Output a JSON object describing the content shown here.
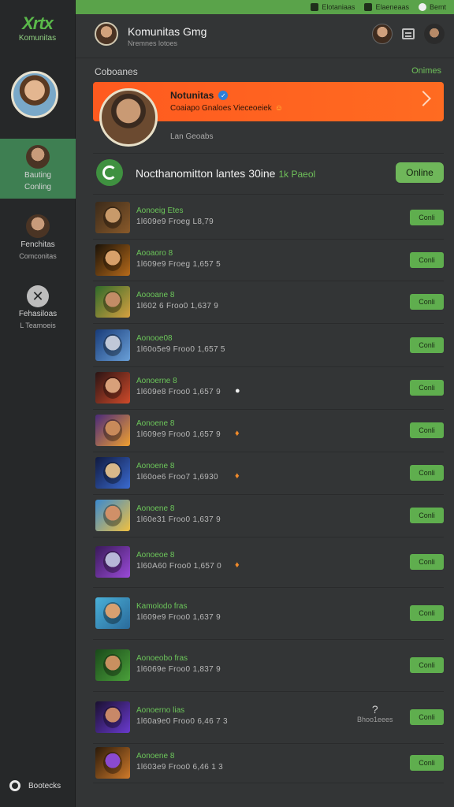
{
  "top_strip": {
    "items": [
      "Elotaniaas",
      "Elaeneaas",
      "Bemt"
    ]
  },
  "sidebar": {
    "logo_mark": "Xrtx",
    "logo_text": "Komunitas",
    "active_item": {
      "line1": "Bauting",
      "line2": "Conling"
    },
    "items": [
      {
        "line1": "Fenchitas",
        "line2": "Comconitas"
      },
      {
        "line1": "Fehasiloas",
        "line2": "L Teamoeis"
      }
    ],
    "bottom_label": "Bootecks"
  },
  "header": {
    "title": "Komunitas Gmg",
    "subtitle": "Nremnes lotoes"
  },
  "section": {
    "label": "Coboanes",
    "link": "Onimes"
  },
  "featured": {
    "title": "Notunitas",
    "verified_icon": "verified-icon",
    "subtitle": "Coaiapo Gnaloes Vieceoeiek",
    "emoji": "☺",
    "meta": "Lan Geoabs"
  },
  "online_bar": {
    "text": "Nocthanomitton lantes 30ine",
    "highlight": "1k Paeol",
    "button": "Online"
  },
  "rows": [
    {
      "name": "Aonoeig Etes",
      "info": "1l609e9 Froeg L8,79",
      "emoji": "",
      "side_big": "",
      "side_small": "",
      "button": "Conli",
      "thumb": [
        "#3a2a1a",
        "#8a5a2a",
        "#c89a6a"
      ]
    },
    {
      "name": "Aooaoro 8",
      "info": "1l609e9 Froeg 1,657 5",
      "emoji": "",
      "side_big": "",
      "side_small": "",
      "button": "Conli",
      "thumb": [
        "#1a1208",
        "#b66a1a",
        "#d8a06a"
      ]
    },
    {
      "name": "Aoooane 8",
      "info": "1l602 6 Froo0 1,637 9",
      "emoji": "",
      "side_big": "",
      "side_small": "",
      "button": "Conli",
      "thumb": [
        "#2f6a2a",
        "#d6a040",
        "#c38c66"
      ]
    },
    {
      "name": "Aonooe08",
      "info": "1l60o5e9 Froo0 1,657 5",
      "emoji": "",
      "side_big": "",
      "side_small": "",
      "button": "Conli",
      "thumb": [
        "#183c7a",
        "#6aa0d8",
        "#c0c8d8"
      ]
    },
    {
      "name": "Aonoerne 8",
      "info": "1l609e8 Froo0 1,657 9",
      "emoji": "●",
      "side_big": "",
      "side_small": "",
      "button": "Conli",
      "thumb": [
        "#2a1414",
        "#d04a2a",
        "#d8a07a"
      ]
    },
    {
      "name": "Aonoene 8",
      "info": "1l609e9 Froo0 1,657 9",
      "emoji": "♦",
      "side_big": "",
      "side_small": "",
      "button": "Conli",
      "thumb": [
        "#4a2a7a",
        "#f0a030",
        "#c88a5a"
      ]
    },
    {
      "name": "Aonoene 8",
      "info": "1l60oe6 Froo7 1,6930",
      "emoji": "♦",
      "side_big": "",
      "side_small": "",
      "button": "Conli",
      "thumb": [
        "#101a40",
        "#3a6ad0",
        "#d8b88a"
      ]
    },
    {
      "name": "Aonoene 8",
      "info": "1l60e31 Froo0 1,637 9",
      "emoji": "",
      "side_big": "",
      "side_small": "",
      "button": "Conli",
      "thumb": [
        "#3a8ad0",
        "#f0c040",
        "#d09068"
      ]
    },
    {
      "name": "Aonoeoe 8",
      "info": "1l60A60 Froo0 1,657 0",
      "emoji": "♦",
      "side_big": "",
      "side_small": "",
      "button": "Conli",
      "thumb": [
        "#3a1a5a",
        "#9a4ad8",
        "#b8b8d8"
      ]
    },
    {
      "name": "Kamolodo fras",
      "info": "1l609e9 Froo0 1,637 9",
      "emoji": "",
      "side_big": "",
      "side_small": "",
      "button": "Conli",
      "thumb": [
        "#4ab0d8",
        "#2a6a9a",
        "#d8a070"
      ]
    },
    {
      "name": "Aonoeobo fras",
      "info": "1l6069e Froo0 1,837 9",
      "emoji": "",
      "side_big": "",
      "side_small": "",
      "button": "Conli",
      "thumb": [
        "#1a4a1a",
        "#4aa03a",
        "#c89060"
      ]
    },
    {
      "name": "Aonoerno lias",
      "info": "1l60a9e0 Froo0 6,46 7 3",
      "emoji": "",
      "side_big": "?",
      "side_small": "Bhoo1eees",
      "button": "Conli",
      "thumb": [
        "#1a1030",
        "#6a3ad0",
        "#c88868"
      ]
    },
    {
      "name": "Aonoene 8",
      "info": "1l603e9 Froo0 6,46 1 3",
      "emoji": "",
      "side_big": "",
      "side_small": "",
      "button": "Conli",
      "thumb": [
        "#2a1a0a",
        "#d07a2a",
        "#8a4ad0"
      ]
    }
  ],
  "colors": {
    "accent_green": "#5fae4e",
    "banner_orange": "#ff5a1f",
    "background": "#333536",
    "sidebar": "#262829",
    "active_item": "#3e7f52"
  }
}
